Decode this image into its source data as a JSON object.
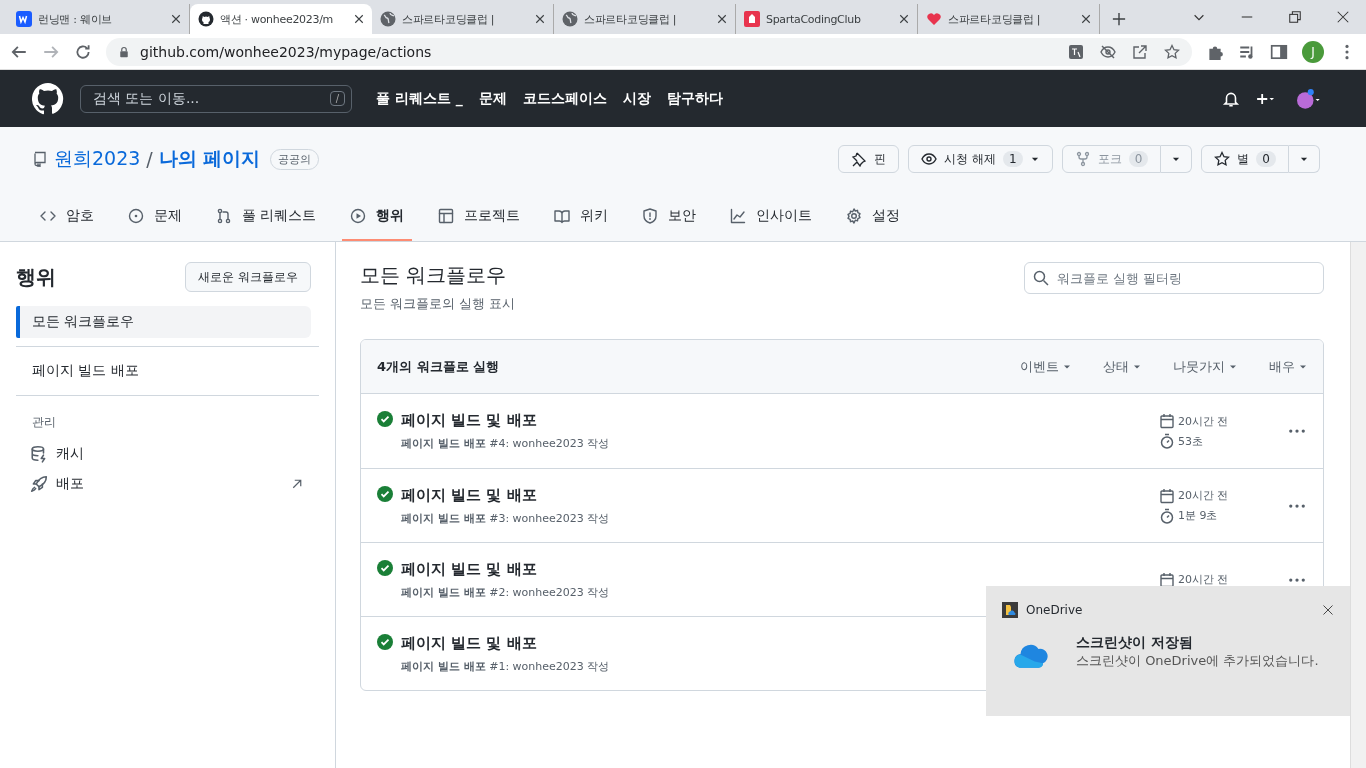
{
  "browser": {
    "tabs": [
      {
        "title": "런닝맨 : 웨이브",
        "kind": "w",
        "selected": false
      },
      {
        "title": "액션 · wonhee2023/m",
        "kind": "github",
        "selected": true
      },
      {
        "title": "스파르타코딩클럽 |",
        "kind": "globe",
        "selected": false
      },
      {
        "title": "스파르타코딩클럽 |",
        "kind": "globe",
        "selected": false
      },
      {
        "title": "SpartaCodingClub",
        "kind": "sparta",
        "selected": false
      },
      {
        "title": "스파르타코딩클럽 |",
        "kind": "heart",
        "selected": false
      }
    ],
    "url": "github.com/wonhee2023/mypage/actions",
    "profile": "J"
  },
  "header": {
    "search_placeholder": "검색 또는 이동...",
    "shortcut": "/",
    "nav": [
      "풀 리퀘스트 _",
      "문제",
      "코드스페이스",
      "시장",
      "탐구하다"
    ]
  },
  "repo": {
    "owner": "원희2023",
    "separator": "/",
    "name": "나의 페이지",
    "visibility": "공공의",
    "pin": "핀",
    "watch": {
      "label": "시청 해제",
      "count": "1"
    },
    "fork": {
      "label": "포크",
      "count": "0",
      "disabled": true
    },
    "star": {
      "label": "별",
      "count": "0"
    }
  },
  "repo_tabs": [
    {
      "label": "암호",
      "kind": "code",
      "selected": false
    },
    {
      "label": "문제",
      "kind": "issue",
      "selected": false
    },
    {
      "label": "풀 리퀘스트",
      "kind": "pr",
      "selected": false
    },
    {
      "label": "행위",
      "kind": "play",
      "selected": true
    },
    {
      "label": "프로젝트",
      "kind": "table",
      "selected": false
    },
    {
      "label": "위키",
      "kind": "book",
      "selected": false
    },
    {
      "label": "보안",
      "kind": "shield",
      "selected": false
    },
    {
      "label": "인사이트",
      "kind": "graph",
      "selected": false
    },
    {
      "label": "설정",
      "kind": "gear",
      "selected": false
    }
  ],
  "sidebar": {
    "title": "행위",
    "new_button": "새로운 워크플로우",
    "workflows": [
      {
        "label": "모든 워크플로우",
        "selected": true
      },
      {
        "label": "페이지 빌드 배포",
        "selected": false
      }
    ],
    "section": "관리",
    "management": [
      {
        "label": "캐시",
        "kind": "cache",
        "external": false
      },
      {
        "label": "배포",
        "kind": "rocket",
        "external": true
      }
    ]
  },
  "main": {
    "title": "모든 워크플로우",
    "subtitle": "모든 워크플로의 실행 표시",
    "filter_placeholder": "워크플로 실행 필터링",
    "runs_count": "4개의 워크플로 실행",
    "filters": [
      "이벤트",
      "상태",
      "나뭇가지",
      "배우"
    ],
    "runs": [
      {
        "title": "페이지 빌드 및 배포",
        "subtitle": "**페이지 빌드 배포** #4: wonhee2023 작성",
        "time": "20시간 전",
        "duration": "53초"
      },
      {
        "title": "페이지 빌드 및 배포",
        "subtitle": "**페이지 빌드 배포** #3: wonhee2023 작성",
        "time": "20시간 전",
        "duration": "1분 9초"
      },
      {
        "title": "페이지 빌드 및 배포",
        "subtitle": "**페이지 빌드 배포** #2: wonhee2023 작성",
        "time": "20시간 전"
      },
      {
        "title": "페이지 빌드 및 배포",
        "subtitle": "**페이지 빌드 배포** #1: wonhee2023 작성"
      }
    ]
  },
  "toast": {
    "app": "OneDrive",
    "title": "스크린샷이 저장됨",
    "message": "스크린샷이 OneDrive에 추가되었습니다."
  }
}
